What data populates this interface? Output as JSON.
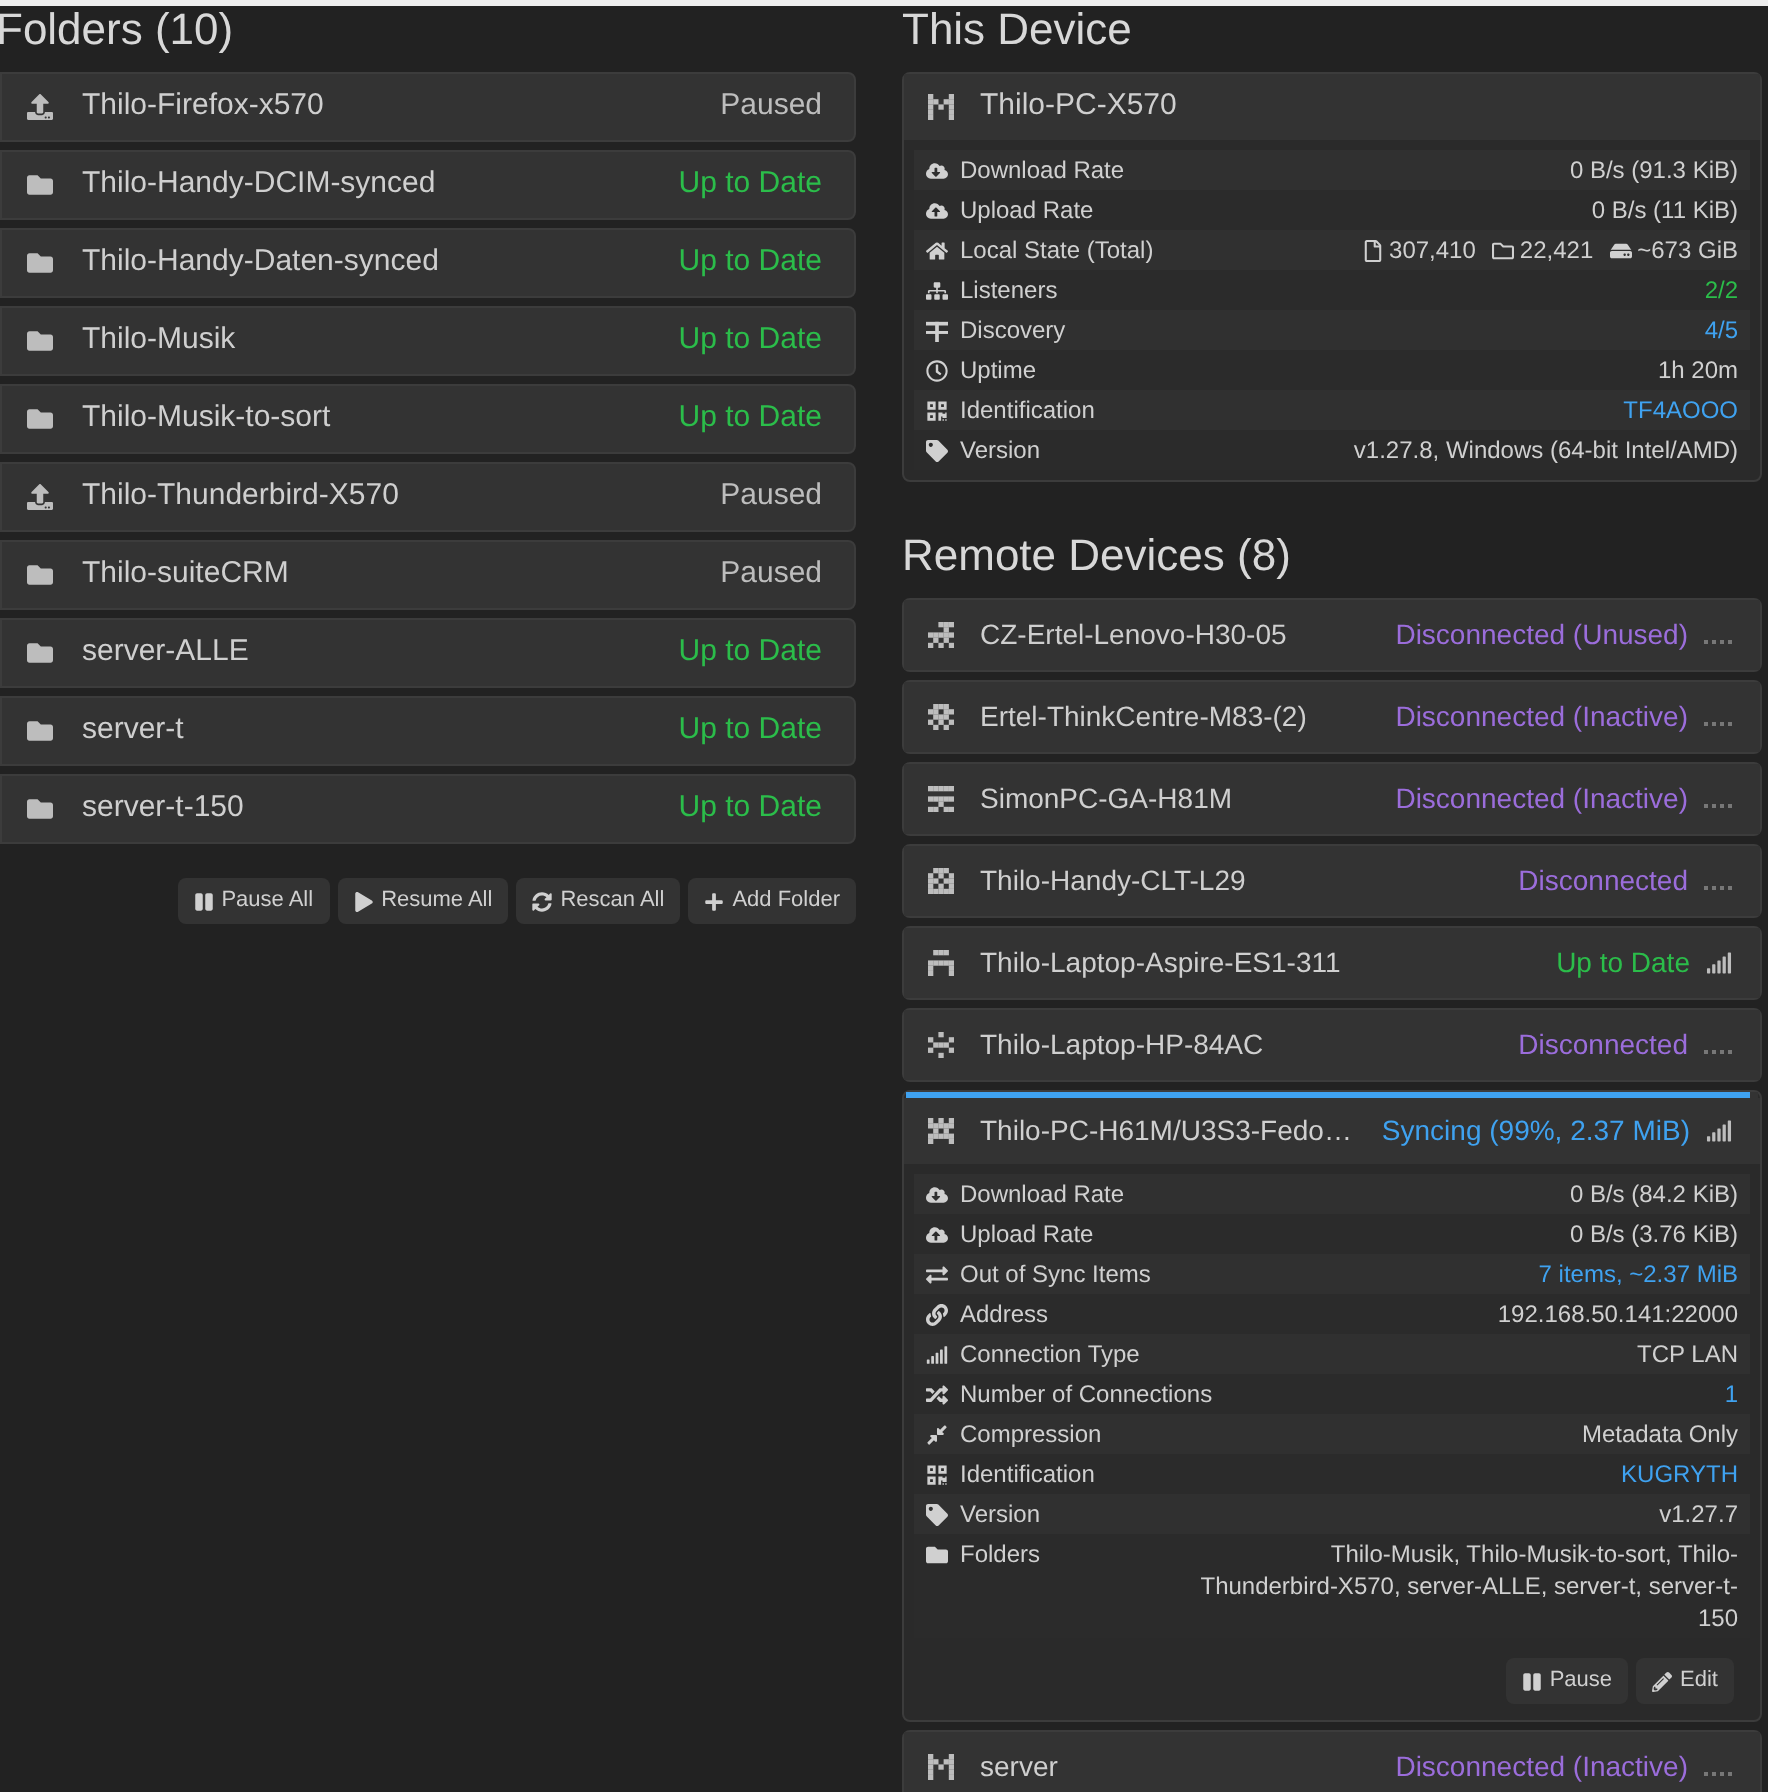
{
  "folders": {
    "title": "Folders (10)",
    "items": [
      {
        "name": "Thilo-Firefox-x570",
        "kind": "sendonly",
        "status": {
          "text": "Paused",
          "kind": "paused"
        }
      },
      {
        "name": "Thilo-Handy-DCIM-synced",
        "kind": "sendreceive",
        "status": {
          "text": "Up to Date",
          "kind": "ok"
        }
      },
      {
        "name": "Thilo-Handy-Daten-synced",
        "kind": "sendreceive",
        "status": {
          "text": "Up to Date",
          "kind": "ok"
        }
      },
      {
        "name": "Thilo-Musik",
        "kind": "sendreceive",
        "status": {
          "text": "Up to Date",
          "kind": "ok"
        }
      },
      {
        "name": "Thilo-Musik-to-sort",
        "kind": "sendreceive",
        "status": {
          "text": "Up to Date",
          "kind": "ok"
        }
      },
      {
        "name": "Thilo-Thunderbird-X570",
        "kind": "sendonly",
        "status": {
          "text": "Paused",
          "kind": "paused"
        }
      },
      {
        "name": "Thilo-suiteCRM",
        "kind": "sendreceive",
        "status": {
          "text": "Paused",
          "kind": "paused"
        }
      },
      {
        "name": "server-ALLE",
        "kind": "sendreceive",
        "status": {
          "text": "Up to Date",
          "kind": "ok"
        }
      },
      {
        "name": "server-t",
        "kind": "sendreceive",
        "status": {
          "text": "Up to Date",
          "kind": "ok"
        }
      },
      {
        "name": "server-t-150",
        "kind": "sendreceive",
        "status": {
          "text": "Up to Date",
          "kind": "ok"
        }
      }
    ],
    "buttons": [
      "Pause All",
      "Resume All",
      "Rescan All",
      "Add Folder"
    ]
  },
  "this_device": {
    "title": "This Device",
    "name": "Thilo-PC-X570",
    "rows": [
      {
        "label": "Download Rate",
        "value": "0 B/s (91.3 KiB)",
        "kind": "plain"
      },
      {
        "label": "Upload Rate",
        "value": "0 B/s (11 KiB)",
        "kind": "plain"
      },
      {
        "label": "Local State (Total)",
        "kind": "counts",
        "counts": [
          "307,410",
          "22,421",
          "~673 GiB"
        ]
      },
      {
        "label": "Listeners",
        "value": "2/2",
        "kind": "good"
      },
      {
        "label": "Discovery",
        "value": "4/5",
        "kind": "link"
      },
      {
        "label": "Uptime",
        "value": "1h 20m",
        "kind": "plain"
      },
      {
        "label": "Identification",
        "value": "TF4AOOO",
        "kind": "link"
      },
      {
        "label": "Version",
        "value": "v1.27.8, Windows (64-bit Intel/AMD)",
        "kind": "plain"
      }
    ]
  },
  "remote_devices": {
    "title": "Remote Devices (8)",
    "items": [
      {
        "name": "CZ-Ertel-Lenovo-H30-05",
        "status": {
          "text": "Disconnected (Unused)",
          "kind": "disconnected"
        },
        "expanded": false
      },
      {
        "name": "Ertel-ThinkCentre-M83-(2)",
        "status": {
          "text": "Disconnected (Inactive)",
          "kind": "disconnected"
        },
        "expanded": false
      },
      {
        "name": "SimonPC-GA-H81M",
        "status": {
          "text": "Disconnected (Inactive)",
          "kind": "disconnected"
        },
        "expanded": false
      },
      {
        "name": "Thilo-Handy-CLT-L29",
        "status": {
          "text": "Disconnected",
          "kind": "disconnected"
        },
        "expanded": false
      },
      {
        "name": "Thilo-Laptop-Aspire-ES1-311",
        "status": {
          "text": "Up to Date",
          "kind": "ok"
        },
        "expanded": false
      },
      {
        "name": "Thilo-Laptop-HP-84AC",
        "status": {
          "text": "Disconnected",
          "kind": "disconnected"
        },
        "expanded": false
      },
      {
        "name": "Thilo-PC-H61M/U3S3-Fedo…",
        "status": {
          "text": "Syncing (99%, 2.37 MiB)",
          "kind": "syncing"
        },
        "expanded": true,
        "level": 0.99,
        "rows": [
          {
            "label": "Download Rate",
            "value": "0 B/s (84.2 KiB)",
            "kind": "plain"
          },
          {
            "label": "Upload Rate",
            "value": "0 B/s (3.76 KiB)",
            "kind": "plain"
          },
          {
            "label": "Out of Sync Items",
            "value": "7 items, ~2.37 MiB",
            "kind": "link"
          },
          {
            "label": "Address",
            "value": "192.168.50.141:22000",
            "kind": "plain"
          },
          {
            "label": "Connection Type",
            "value": "TCP LAN",
            "kind": "plain"
          },
          {
            "label": "Number of Connections",
            "value": "1",
            "kind": "link"
          },
          {
            "label": "Compression",
            "value": "Metadata Only",
            "kind": "plain"
          },
          {
            "label": "Identification",
            "value": "KUGRYTH",
            "kind": "link"
          },
          {
            "label": "Version",
            "value": "v1.27.7",
            "kind": "plain"
          },
          {
            "label": "Folders",
            "value": "Thilo-Musik, Thilo-Musik-to-sort, Thilo-Thunderbird-X570, server-ALLE, server-t, server-t-150",
            "kind": "plain"
          }
        ],
        "buttons": [
          "Pause",
          "Edit"
        ]
      },
      {
        "name": "server",
        "status": {
          "text": "Disconnected (Inactive)",
          "kind": "disconnected"
        },
        "expanded": false
      }
    ]
  }
}
